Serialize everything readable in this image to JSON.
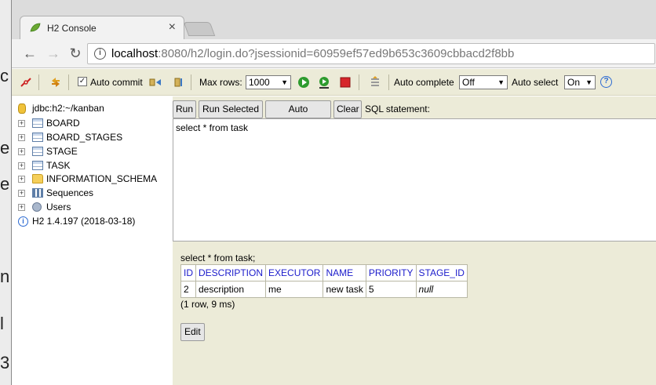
{
  "browser": {
    "tab_title": "H2 Console",
    "tab_close": "×",
    "url_host": "localhost",
    "url_rest": ":8080/h2/login.do?jsessionid=60959ef57ed9b653c3609cbbacd2f8bb"
  },
  "toolbar": {
    "auto_commit_label": "Auto commit",
    "auto_commit_checked": true,
    "max_rows_label": "Max rows:",
    "max_rows_value": "1000",
    "auto_complete_label": "Auto complete",
    "auto_complete_value": "Off",
    "auto_select_label": "Auto select",
    "auto_select_value": "On",
    "help_glyph": "?"
  },
  "tree": {
    "connection": "jdbc:h2:~/kanban",
    "items": [
      {
        "label": "BOARD",
        "icon": "table-icon"
      },
      {
        "label": "BOARD_STAGES",
        "icon": "table-icon"
      },
      {
        "label": "STAGE",
        "icon": "table-icon"
      },
      {
        "label": "TASK",
        "icon": "table-icon"
      },
      {
        "label": "INFORMATION_SCHEMA",
        "icon": "folder-icon"
      },
      {
        "label": "Sequences",
        "icon": "sequences-icon"
      },
      {
        "label": "Users",
        "icon": "users-icon"
      }
    ],
    "version": "H2 1.4.197 (2018-03-18)"
  },
  "query": {
    "run_label": "Run",
    "run_selected_label": "Run Selected",
    "auto_complete_label": "Auto complete",
    "clear_label": "Clear",
    "sql_label": "SQL statement:",
    "sql_text": "select * from task"
  },
  "result": {
    "statement": "select * from task;",
    "columns": [
      "ID",
      "DESCRIPTION",
      "EXECUTOR",
      "NAME",
      "PRIORITY",
      "STAGE_ID"
    ],
    "rows": [
      [
        "2",
        "description",
        "me",
        "new task",
        "5",
        "null"
      ]
    ],
    "meta": "(1 row, 9 ms)",
    "edit_label": "Edit"
  }
}
